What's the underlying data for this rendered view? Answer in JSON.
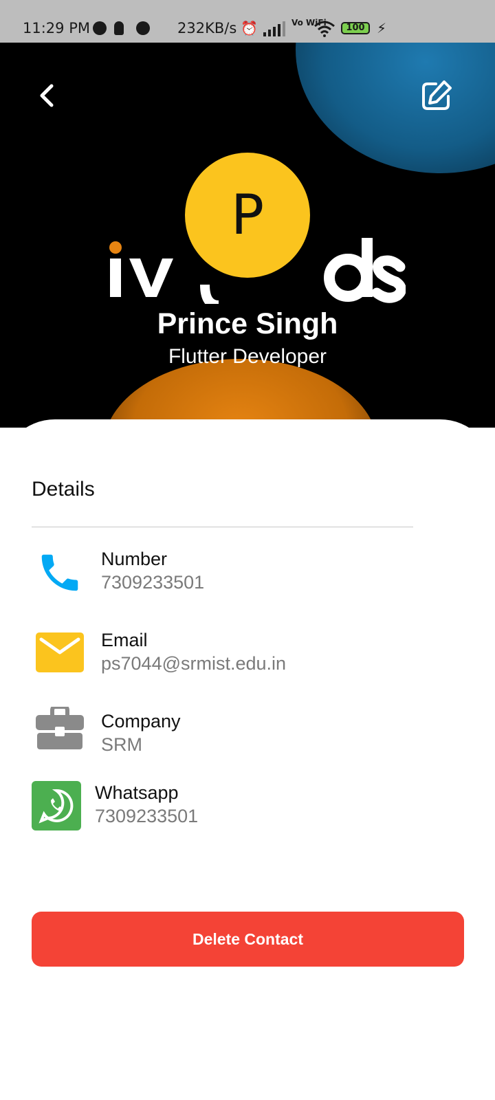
{
  "status_bar": {
    "time": "11:29 PM",
    "network_speed": "232KB/s",
    "network_type": "Vo WiFi",
    "battery_level": "100"
  },
  "header": {
    "back_icon": "chevron-left-icon",
    "edit_icon": "edit-icon"
  },
  "profile": {
    "avatar_initial": "P",
    "name": "Prince Singh",
    "title": "Flutter Developer",
    "avatar_color": "#fbc41e"
  },
  "details": {
    "section_title": "Details",
    "items": [
      {
        "label": "Number",
        "value": "7309233501",
        "icon": "phone-icon",
        "icon_color": "#03a9f4"
      },
      {
        "label": "Email",
        "value": "ps7044@srmist.edu.in",
        "icon": "email-icon",
        "icon_color": "#fbc41e"
      },
      {
        "label": "Company",
        "value": "SRM",
        "icon": "briefcase-icon",
        "icon_color": "#8a8a8a"
      },
      {
        "label": "Whatsapp",
        "value": "7309233501",
        "icon": "whatsapp-icon",
        "icon_color": "#4caf50"
      }
    ]
  },
  "actions": {
    "delete_label": "Delete Contact",
    "delete_color": "#f44336"
  }
}
